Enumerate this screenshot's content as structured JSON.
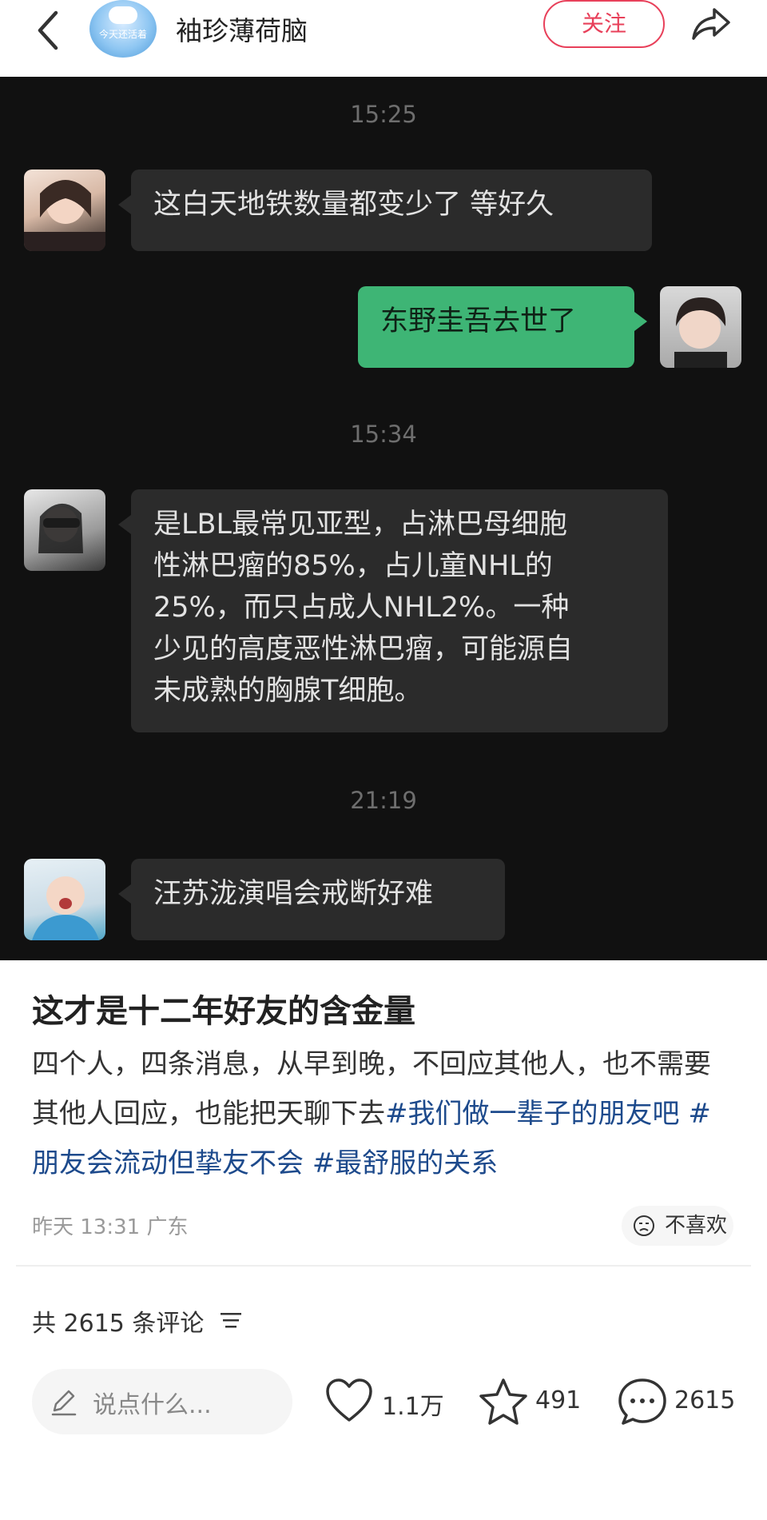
{
  "header": {
    "author_name": "袖珍薄荷脑",
    "avatar_caption": "今天还活着",
    "follow_label": "关注"
  },
  "chat": {
    "timestamps": [
      "15:25",
      "15:34",
      "21:19"
    ],
    "messages": [
      {
        "side": "left",
        "text": "这白天地铁数量都变少了  等好久"
      },
      {
        "side": "right",
        "text": "东野圭吾去世了"
      },
      {
        "side": "left",
        "text": "是LBL最常见亚型，占淋巴母细胞\n性淋巴瘤的85%，占儿童NHL的\n25%，而只占成人NHL2%。一种\n少见的高度恶性淋巴瘤，可能源自\n未成熟的胸腺T细胞。"
      },
      {
        "side": "left",
        "text": "汪苏泷演唱会戒断好难"
      }
    ]
  },
  "post": {
    "title": "这才是十二年好友的含金量",
    "body": "四个人，四条消息，从早到晚，不回应其他人，也不需要其他人回应，也能把天聊下去",
    "tags": [
      "#我们做一辈子的朋友吧",
      "#朋友会流动但挚友不会",
      "#最舒服的关系"
    ],
    "meta": "昨天 13:31 广东",
    "dislike_label": "不喜欢"
  },
  "comments": {
    "count_label": "共 2615 条评论"
  },
  "bottom_bar": {
    "input_placeholder": "说点什么...",
    "likes": "1.1万",
    "favorites": "491",
    "comments": "2615"
  },
  "colors": {
    "accent_red": "#e8405a",
    "bubble_green": "#3eb575",
    "chat_bg": "#111111",
    "tag_blue": "#1d4a8c"
  }
}
